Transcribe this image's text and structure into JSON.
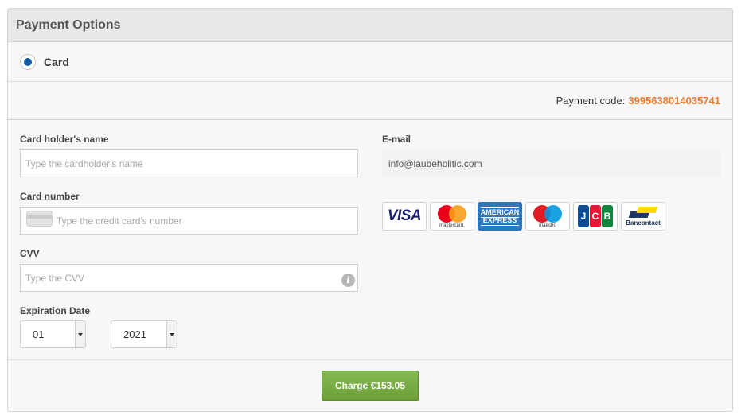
{
  "panel": {
    "title": "Payment Options"
  },
  "method": {
    "label": "Card",
    "selected": true
  },
  "payment_code": {
    "label": "Payment code:",
    "value": "3995638014035741"
  },
  "form": {
    "cardholder": {
      "label": "Card holder's name",
      "placeholder": "Type the cardholder's name"
    },
    "card_number": {
      "label": "Card number",
      "placeholder": "Type the credit card's number"
    },
    "cvv": {
      "label": "CVV",
      "placeholder": "Type the CVV"
    },
    "expiration": {
      "label": "Expiration Date",
      "month": "01",
      "year": "2021"
    },
    "email": {
      "label": "E-mail",
      "value": "info@laubeholitic.com"
    }
  },
  "card_logos": {
    "visa": "VISA",
    "mastercard": "mastercard.",
    "amex_line1": "AMERICAN",
    "amex_line2": "EXPRESS",
    "maestro": "maestro",
    "jcb": [
      "J",
      "C",
      "B"
    ],
    "bancontact": "Bancontact"
  },
  "charge_button": {
    "label": "Charge €153.05"
  },
  "colors": {
    "accent_orange": "#f07a2c",
    "radio_blue": "#0f5ea8",
    "button_green": "#76a844"
  }
}
